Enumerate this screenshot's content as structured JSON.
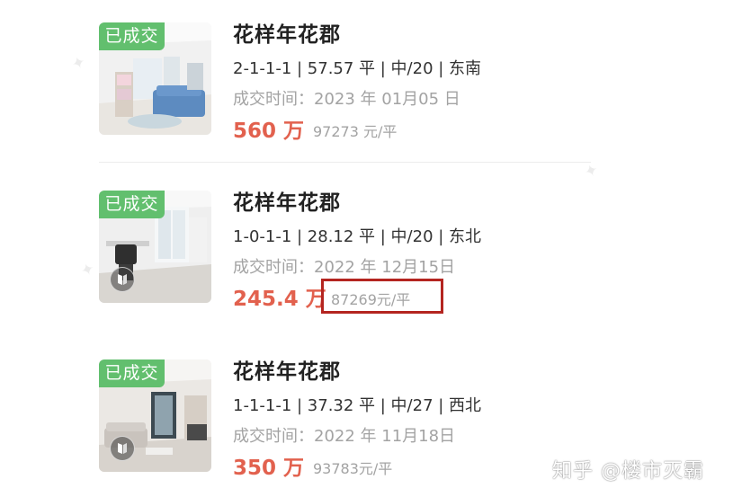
{
  "listings": [
    {
      "badge": "已成交",
      "title": "花样年花郡",
      "spec": "2-1-1-1 | 57.57 平 | 中/20 | 东南",
      "deal_time": "成交时间：2023 年 01月05 日",
      "price": "560 万",
      "unit_price": "97273 元/平",
      "has_vr_icon": false
    },
    {
      "badge": "已成交",
      "title": "花样年花郡",
      "spec": "1-0-1-1 | 28.12 平 | 中/20 | 东北",
      "deal_time": "成交时间：2022 年 12月15日",
      "price": "245.4 万",
      "unit_price": "87269元/平",
      "has_vr_icon": true,
      "highlighted": true
    },
    {
      "badge": "已成交",
      "title": "花样年花郡",
      "spec": "1-1-1-1 | 37.32 平 | 中/27 | 西北",
      "deal_time": "成交时间：2022 年 11月18日",
      "price": "350 万",
      "unit_price": "93783元/平",
      "has_vr_icon": true
    }
  ],
  "watermark": {
    "text": "知乎 @楼市灭霸"
  },
  "colors": {
    "badge_bg": "#62bf6e",
    "price": "#e2614e",
    "highlight_border": "#b42520",
    "muted_text": "#a3a3a3"
  },
  "icons": {
    "vr": "vr-panorama-icon"
  }
}
